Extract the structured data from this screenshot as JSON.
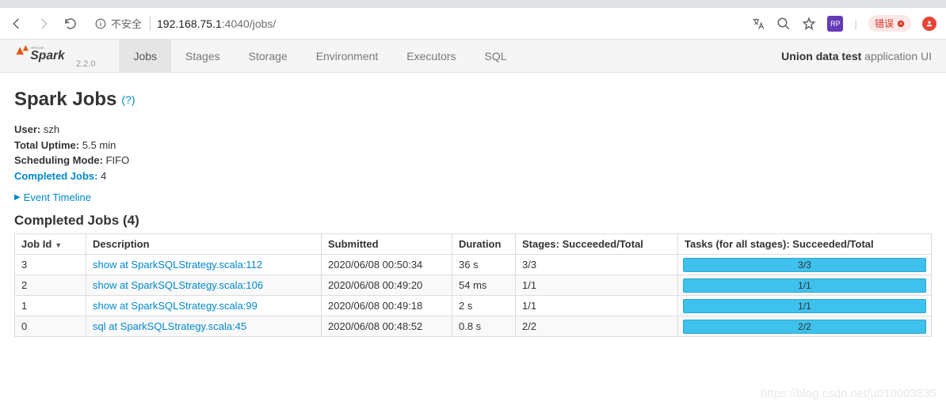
{
  "browser": {
    "insecure_label": "不安全",
    "url_host": "192.168.75.1",
    "url_port": ":4040",
    "url_path": "/jobs/",
    "translate_badge_text": "错误",
    "ext_badge": "RP"
  },
  "nav": {
    "version": "2.2.0",
    "tabs": [
      "Jobs",
      "Stages",
      "Storage",
      "Environment",
      "Executors",
      "SQL"
    ],
    "active_tab": "Jobs",
    "app_name": "Union data test",
    "app_suffix": "application UI"
  },
  "page": {
    "heading": "Spark Jobs",
    "help": "(?)",
    "meta": {
      "user_label": "User:",
      "user_value": "szh",
      "uptime_label": "Total Uptime:",
      "uptime_value": "5.5 min",
      "sched_label": "Scheduling Mode:",
      "sched_value": "FIFO",
      "completed_label": "Completed Jobs:",
      "completed_value": "4"
    },
    "event_timeline": "Event Timeline",
    "section_heading": "Completed Jobs (4)"
  },
  "table": {
    "headers": {
      "job_id": "Job Id",
      "description": "Description",
      "submitted": "Submitted",
      "duration": "Duration",
      "stages": "Stages: Succeeded/Total",
      "tasks": "Tasks (for all stages): Succeeded/Total"
    },
    "rows": [
      {
        "id": "3",
        "desc": "show at SparkSQLStrategy.scala:112",
        "submitted": "2020/06/08 00:50:34",
        "duration": "36 s",
        "stages": "3/3",
        "tasks": "3/3"
      },
      {
        "id": "2",
        "desc": "show at SparkSQLStrategy.scala:106",
        "submitted": "2020/06/08 00:49:20",
        "duration": "54 ms",
        "stages": "1/1",
        "tasks": "1/1"
      },
      {
        "id": "1",
        "desc": "show at SparkSQLStrategy.scala:99",
        "submitted": "2020/06/08 00:49:18",
        "duration": "2 s",
        "stages": "1/1",
        "tasks": "1/1"
      },
      {
        "id": "0",
        "desc": "sql at SparkSQLStrategy.scala:45",
        "submitted": "2020/06/08 00:48:52",
        "duration": "0.8 s",
        "stages": "2/2",
        "tasks": "2/2"
      }
    ]
  },
  "watermark": "https://blog.csdn.net/u010003835"
}
